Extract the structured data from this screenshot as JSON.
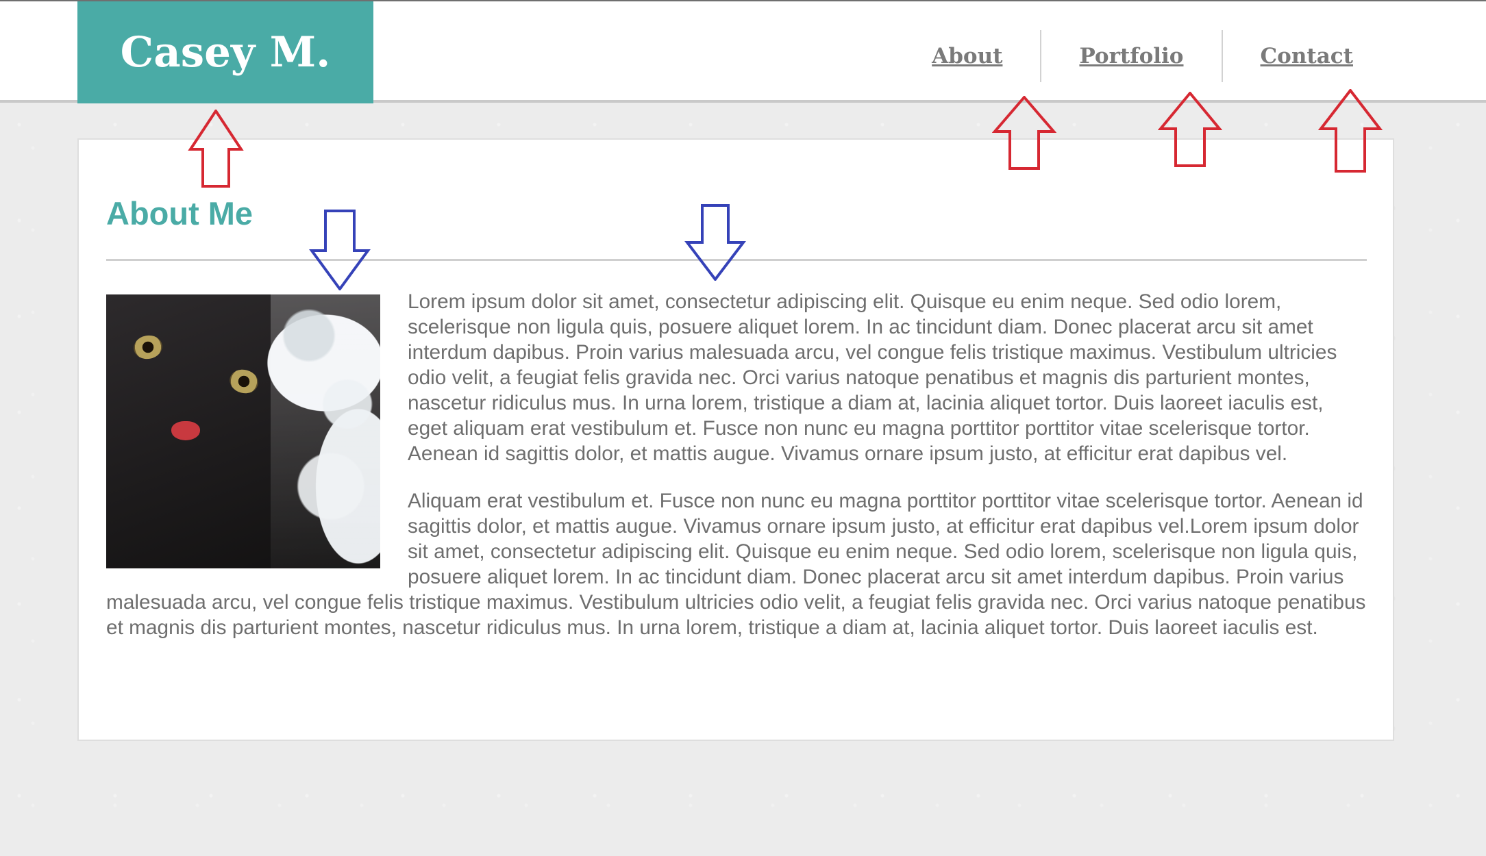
{
  "site": {
    "brand": "Casey M."
  },
  "nav": {
    "items": [
      {
        "label": "About"
      },
      {
        "label": "Portfolio"
      },
      {
        "label": "Contact"
      }
    ]
  },
  "main": {
    "title": "About Me",
    "paragraphs": [
      "Lorem ipsum dolor sit amet, consectetur adipiscing elit. Quisque eu enim neque. Sed odio lorem, scelerisque non ligula quis, posuere aliquet lorem. In ac tincidunt diam. Donec placerat arcu sit amet interdum dapibus. Proin varius malesuada arcu, vel congue felis tristique maximus. Vestibulum ultricies odio velit, a feugiat felis gravida nec. Orci varius natoque penatibus et magnis dis parturient montes, nascetur ridiculus mus. In urna lorem, tristique a diam at, lacinia aliquet tortor. Duis laoreet iaculis est, eget aliquam erat vestibulum et. Fusce non nunc eu magna porttitor porttitor vitae scelerisque tortor. Aenean id sagittis dolor, et mattis augue. Vivamus ornare ipsum justo, at efficitur erat dapibus vel.",
      "Aliquam erat vestibulum et. Fusce non nunc eu magna porttitor porttitor vitae scelerisque tortor. Aenean id sagittis dolor, et mattis augue. Vivamus ornare ipsum justo, at efficitur erat dapibus vel.Lorem ipsum dolor sit amet, consectetur adipiscing elit. Quisque eu enim neque. Sed odio lorem, scelerisque non ligula quis, posuere aliquet lorem. In ac tincidunt diam. Donec placerat arcu sit amet interdum dapibus. Proin varius malesuada arcu, vel congue felis tristique maximus. Vestibulum ultricies odio velit, a feugiat felis gravida nec. Orci varius natoque penatibus et magnis dis parturient montes, nascetur ridiculus mus. In urna lorem, tristique a diam at, lacinia aliquet tortor. Duis laoreet iaculis est."
    ]
  },
  "colors": {
    "accent": "#4aaba6",
    "text": "#6e6e6e",
    "nav_text": "#7a7a7a",
    "page_bg": "#ececec",
    "annotation_red": "#d62832",
    "annotation_blue": "#3542b8"
  },
  "annotations": {
    "icons": [
      "up-arrow-icon",
      "down-arrow-icon"
    ]
  }
}
